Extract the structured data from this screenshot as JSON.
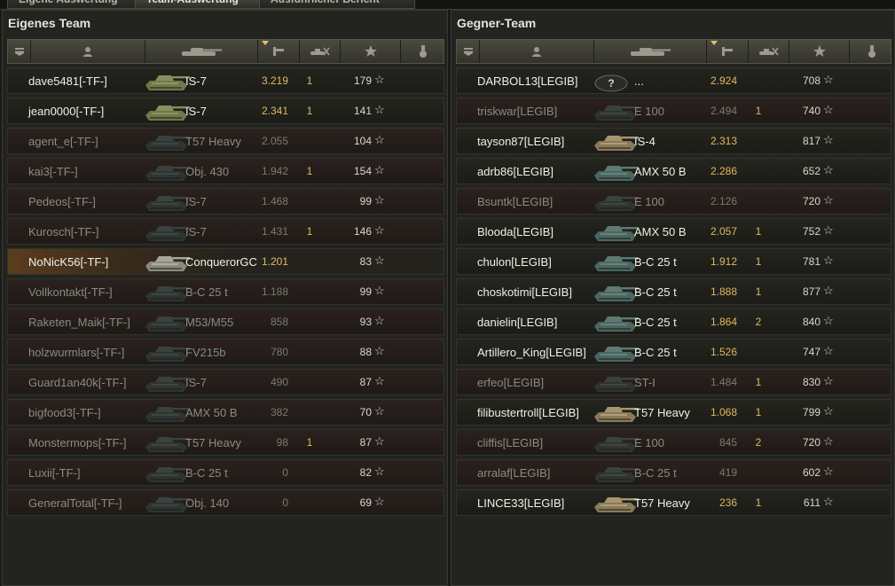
{
  "tabs": [
    {
      "label": "Eigene Auswertung"
    },
    {
      "label": "Team-Auswertung"
    },
    {
      "label": "Ausführlicher Bericht"
    }
  ],
  "columns": {
    "icons": [
      "platoon-icon",
      "player-icon",
      "tank-icon",
      "damage-icon",
      "kills-icon",
      "xp-star-icon",
      "medal-icon"
    ],
    "sorted_column": "damage"
  },
  "own_team": {
    "title": "Eigenes Team",
    "rows": [
      {
        "name": "dave5481[-TF-]",
        "vehicle": "IS-7",
        "damage": "3.219",
        "kills": "1",
        "xp": "179",
        "state": "alive",
        "camo": "green"
      },
      {
        "name": "jean0000[-TF-]",
        "vehicle": "IS-7",
        "damage": "2.341",
        "kills": "1",
        "xp": "141",
        "state": "alive",
        "camo": "green"
      },
      {
        "name": "agent_e[-TF-]",
        "vehicle": "T57 Heavy",
        "damage": "2.055",
        "kills": "",
        "xp": "104",
        "state": "dead",
        "camo": "dark"
      },
      {
        "name": "kai3[-TF-]",
        "vehicle": "Obj. 430",
        "damage": "1.942",
        "kills": "1",
        "xp": "154",
        "state": "dead",
        "camo": "dark"
      },
      {
        "name": "Pedeos[-TF-]",
        "vehicle": "IS-7",
        "damage": "1.468",
        "kills": "",
        "xp": "99",
        "state": "dead",
        "camo": "dark"
      },
      {
        "name": "Kurosch[-TF-]",
        "vehicle": "IS-7",
        "damage": "1.431",
        "kills": "1",
        "xp": "146",
        "state": "dead",
        "camo": "dark"
      },
      {
        "name": "NoNicK56[-TF-]",
        "vehicle": "ConquerorGC",
        "damage": "1.201",
        "kills": "",
        "xp": "83",
        "state": "self",
        "camo": "light"
      },
      {
        "name": "Vollkontakt[-TF-]",
        "vehicle": "B-C 25 t",
        "damage": "1.188",
        "kills": "",
        "xp": "99",
        "state": "dead",
        "camo": "dark"
      },
      {
        "name": "Raketen_Maik[-TF-]",
        "vehicle": "M53/M55",
        "damage": "858",
        "kills": "",
        "xp": "93",
        "state": "dead",
        "camo": "dark"
      },
      {
        "name": "holzwurmlars[-TF-]",
        "vehicle": "FV215b",
        "damage": "780",
        "kills": "",
        "xp": "88",
        "state": "dead",
        "camo": "dark"
      },
      {
        "name": "Guard1an40k[-TF-]",
        "vehicle": "IS-7",
        "damage": "490",
        "kills": "",
        "xp": "87",
        "state": "dead",
        "camo": "dark"
      },
      {
        "name": "bigfood3[-TF-]",
        "vehicle": "AMX 50 B",
        "damage": "382",
        "kills": "",
        "xp": "70",
        "state": "dead",
        "camo": "dark"
      },
      {
        "name": "Monstermops[-TF-]",
        "vehicle": "T57 Heavy",
        "damage": "98",
        "kills": "1",
        "xp": "87",
        "state": "dead",
        "camo": "dark"
      },
      {
        "name": "Luxii[-TF-]",
        "vehicle": "B-C 25 t",
        "damage": "0",
        "kills": "",
        "xp": "82",
        "state": "dead",
        "camo": "dark"
      },
      {
        "name": "GeneralTotal[-TF-]",
        "vehicle": "Obj. 140",
        "damage": "0",
        "kills": "",
        "xp": "69",
        "state": "dead",
        "camo": "dark"
      }
    ]
  },
  "enemy_team": {
    "title": "Gegner-Team",
    "rows": [
      {
        "name": "DARBOL13[LEGIB]",
        "vehicle": "...",
        "damage": "2.924",
        "kills": "",
        "xp": "708",
        "state": "alive",
        "camo": "unknown"
      },
      {
        "name": "triskwar[LEGIB]",
        "vehicle": "E 100",
        "damage": "2.494",
        "kills": "1",
        "xp": "740",
        "state": "dead",
        "camo": "dark"
      },
      {
        "name": "tayson87[LEGIB]",
        "vehicle": "IS-4",
        "damage": "2.313",
        "kills": "",
        "xp": "817",
        "state": "alive",
        "camo": "sand"
      },
      {
        "name": "adrb86[LEGIB]",
        "vehicle": "AMX 50 B",
        "damage": "2.286",
        "kills": "",
        "xp": "652",
        "state": "alive",
        "camo": "teal"
      },
      {
        "name": "Bsuntk[LEGIB]",
        "vehicle": "E 100",
        "damage": "2.126",
        "kills": "",
        "xp": "720",
        "state": "dead",
        "camo": "dark"
      },
      {
        "name": "Blooda[LEGIB]",
        "vehicle": "AMX 50 B",
        "damage": "2.057",
        "kills": "1",
        "xp": "752",
        "state": "alive",
        "camo": "teal"
      },
      {
        "name": "chulon[LEGIB]",
        "vehicle": "B-C 25 t",
        "damage": "1.912",
        "kills": "1",
        "xp": "781",
        "state": "alive",
        "camo": "teal"
      },
      {
        "name": "choskotimi[LEGIB]",
        "vehicle": "B-C 25 t",
        "damage": "1.888",
        "kills": "1",
        "xp": "877",
        "state": "alive",
        "camo": "teal"
      },
      {
        "name": "danielin[LEGIB]",
        "vehicle": "B-C 25 t",
        "damage": "1.864",
        "kills": "2",
        "xp": "840",
        "state": "alive",
        "camo": "teal"
      },
      {
        "name": "Artillero_King[LEGIB]",
        "vehicle": "B-C 25 t",
        "damage": "1.526",
        "kills": "",
        "xp": "747",
        "state": "alive",
        "camo": "teal"
      },
      {
        "name": "erfeo[LEGIB]",
        "vehicle": "ST-I",
        "damage": "1.484",
        "kills": "1",
        "xp": "830",
        "state": "dead",
        "camo": "dark"
      },
      {
        "name": "filibustertroll[LEGIB]",
        "vehicle": "T57 Heavy",
        "damage": "1.068",
        "kills": "1",
        "xp": "799",
        "state": "alive",
        "camo": "sand"
      },
      {
        "name": "cliffis[LEGIB]",
        "vehicle": "E 100",
        "damage": "845",
        "kills": "2",
        "xp": "720",
        "state": "dead",
        "camo": "dark"
      },
      {
        "name": "arralaf[LEGIB]",
        "vehicle": "B-C 25 t",
        "damage": "419",
        "kills": "",
        "xp": "602",
        "state": "dead",
        "camo": "dark"
      },
      {
        "name": "LINCE33[LEGIB]",
        "vehicle": "T57 Heavy",
        "damage": "236",
        "kills": "1",
        "xp": "611",
        "state": "alive",
        "camo": "sand"
      }
    ]
  },
  "colors": {
    "accent_gold": "#e0b860",
    "text_alive": "#f0f0e8",
    "text_dead": "#8a8a82",
    "panel_bg": "#232320"
  }
}
